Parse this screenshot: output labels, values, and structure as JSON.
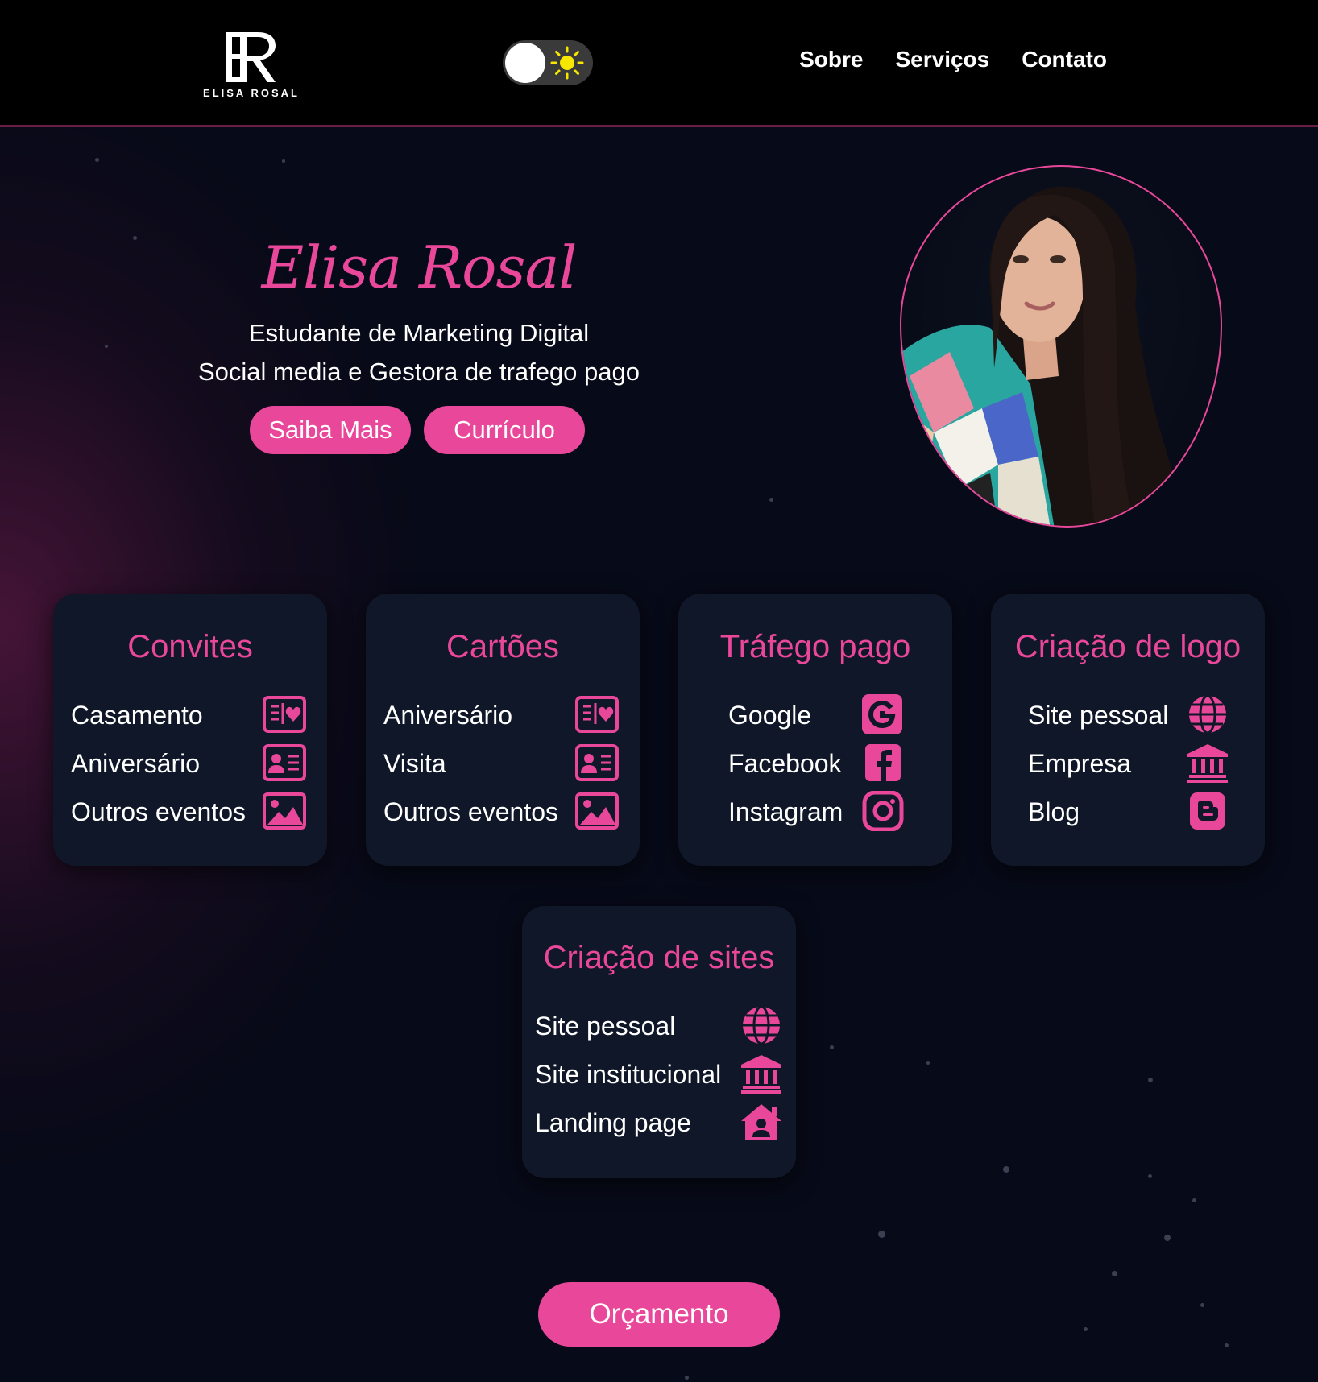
{
  "brand": {
    "monogram": "ER",
    "name": "ELISA ROSAL"
  },
  "theme_toggle": {
    "state": "dark",
    "icon": "sun-icon"
  },
  "nav": {
    "items": [
      "Sobre",
      "Serviços",
      "Contato"
    ]
  },
  "hero": {
    "name": "Elisa Rosal",
    "line1": "Estudante de Marketing Digital",
    "line2": "Social media e Gestora de trafego pago",
    "btn_more": "Saiba Mais",
    "btn_cv": "Currículo"
  },
  "cards": [
    {
      "title": "Convites",
      "items": [
        {
          "label": "Casamento",
          "icon": "invitation-heart-icon"
        },
        {
          "label": "Aniversário",
          "icon": "id-card-icon"
        },
        {
          "label": "Outros eventos",
          "icon": "image-icon"
        }
      ]
    },
    {
      "title": "Cartões",
      "items": [
        {
          "label": "Aniversário",
          "icon": "invitation-heart-icon"
        },
        {
          "label": "Visita",
          "icon": "id-card-icon"
        },
        {
          "label": "Outros eventos",
          "icon": "image-icon"
        }
      ]
    },
    {
      "title": "Tráfego pago",
      "items": [
        {
          "label": "Google",
          "icon": "google-icon"
        },
        {
          "label": "Facebook",
          "icon": "facebook-icon"
        },
        {
          "label": "Instagram",
          "icon": "instagram-icon"
        }
      ]
    },
    {
      "title": "Criação de logo",
      "items": [
        {
          "label": "Site pessoal",
          "icon": "globe-icon"
        },
        {
          "label": "Empresa",
          "icon": "bank-icon"
        },
        {
          "label": "Blog",
          "icon": "blogger-icon"
        }
      ]
    },
    {
      "title": "Criação de sites",
      "items": [
        {
          "label": "Site pessoal",
          "icon": "globe-icon"
        },
        {
          "label": "Site institucional",
          "icon": "bank-icon"
        },
        {
          "label": "Landing page",
          "icon": "house-user-icon"
        }
      ]
    }
  ],
  "budget_button": "Orçamento",
  "colors": {
    "accent": "#e8479a",
    "background": "#070a18",
    "card": "#101728",
    "header": "#000000"
  }
}
